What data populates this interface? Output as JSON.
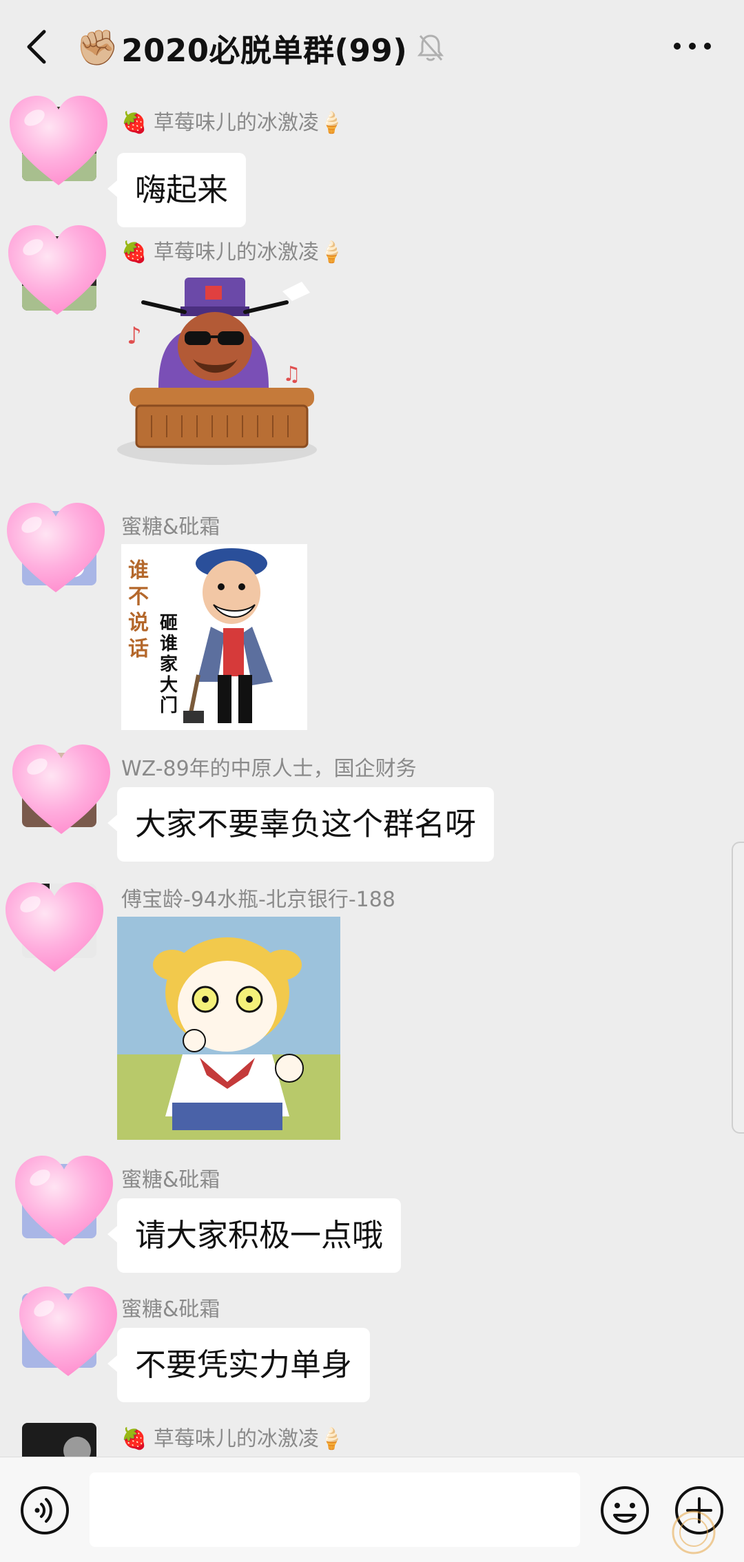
{
  "header": {
    "title_emoji": "✊🏼",
    "title": "2020必脱单群(99)",
    "back_icon": "chevron-left-icon",
    "mute_icon": "bell-off-icon",
    "more_icon": "more-icon"
  },
  "messages": [
    {
      "sender": "🍓 草莓味儿的冰激凌🍦",
      "type": "text",
      "text": "嗨起来"
    },
    {
      "sender": "🍓 草莓味儿的冰激凌🍦",
      "type": "sticker",
      "sticker": "judge-at-desk-sticker"
    },
    {
      "sender": "蜜糖&砒霜",
      "type": "sticker",
      "sticker": "hammer-man-sticker",
      "sticker_text_left": "谁不说话",
      "sticker_text_right": "砸谁家大门"
    },
    {
      "sender": "WZ-89年的中原人士，国企财务",
      "type": "text",
      "text": "大家不要辜负这个群名呀"
    },
    {
      "sender": "傅宝龄-94水瓶-北京银行-188",
      "type": "sticker",
      "sticker": "anime-girl-thumbs-up-sticker"
    },
    {
      "sender": "蜜糖&砒霜",
      "type": "text",
      "text": "请大家积极一点哦"
    },
    {
      "sender": "蜜糖&砒霜",
      "type": "text",
      "text": "不要凭实力单身"
    },
    {
      "sender": "🍓 草莓味儿的冰激凌🍦",
      "type": "text",
      "text": ""
    }
  ],
  "input_bar": {
    "placeholder": "",
    "voice_icon": "voice-icon",
    "emoji_icon": "emoji-icon",
    "plus_icon": "plus-circle-icon"
  },
  "colors": {
    "background": "#ededed",
    "bubble": "#ffffff",
    "sender_text": "#8a8a8a",
    "heart": "#ff9fd0"
  }
}
